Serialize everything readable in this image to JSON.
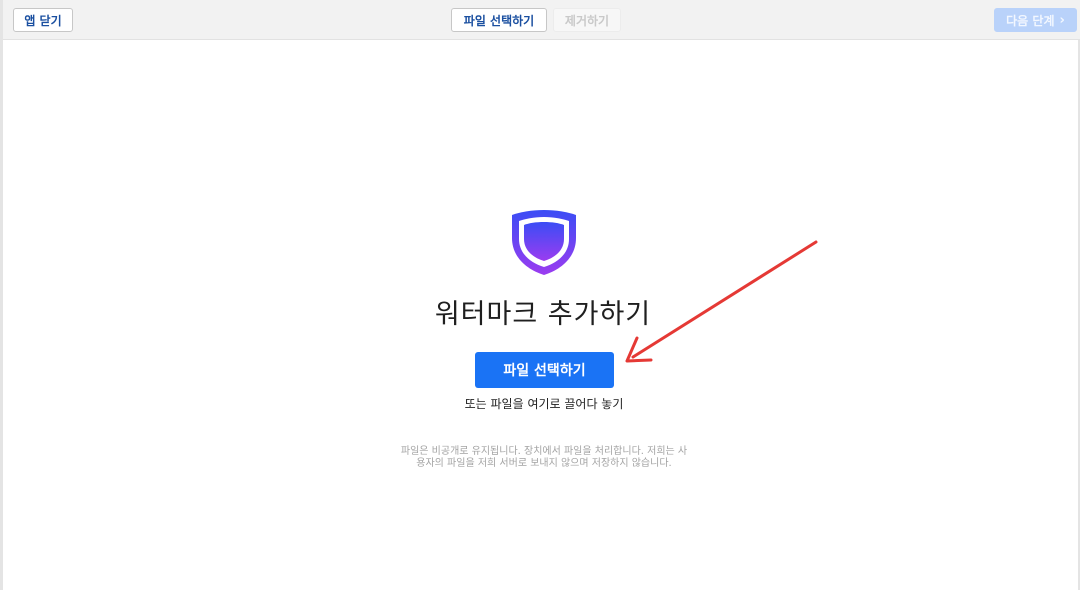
{
  "toolbar": {
    "close_label": "앱 닫기",
    "select_label": "파일 선택하기",
    "remove_label": "제거하기",
    "next_label": "다음 단계",
    "next_chevron": "›"
  },
  "main": {
    "icon": "shield-icon",
    "title": "워터마크 추가하기",
    "select_button": "파일 선택하기",
    "drop_text": "또는 파일을 여기로 끌어다 놓기",
    "privacy_text": "파일은 비공개로 유지됩니다. 장치에서 파일을 처리합니다. 저희는 사용자의 파일을 저희 서버로 보내지 않으며 저장하지 않습니다."
  },
  "colors": {
    "primary_button": "#1a73f5",
    "shield_top": "#3b4df5",
    "shield_bottom": "#9b3cf0",
    "arrow": "#e53935"
  }
}
